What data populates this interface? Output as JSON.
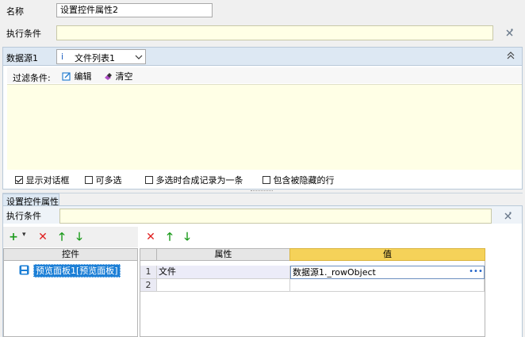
{
  "header": {
    "name_label": "名称",
    "name_value": "设置控件属性2",
    "condition_label": "执行条件",
    "clear_icon": "clear-icon"
  },
  "datasource": {
    "label": "数据源1",
    "combo_prefix": "i",
    "combo_value": "文件列表1",
    "collapse_icon": "double-chevron-up-icon"
  },
  "filter": {
    "label": "过滤条件:",
    "edit_label": "编辑",
    "clear_label": "清空"
  },
  "options": [
    {
      "label": "显示对话框",
      "checked": true
    },
    {
      "label": "可多选",
      "checked": false
    },
    {
      "label": "多选时合成记录为一条",
      "checked": false
    },
    {
      "label": "包含被隐藏的行",
      "checked": false
    }
  ],
  "tab": {
    "title": "设置控件属性",
    "condition_label": "执行条件"
  },
  "left_grid": {
    "header": "控件",
    "item": "预览面板1[预览面板]"
  },
  "right_grid": {
    "headers": [
      "属性",
      "值"
    ],
    "rows": [
      {
        "num": "1",
        "prop": "文件",
        "value": "数据源1._rowObject"
      },
      {
        "num": "2",
        "prop": "",
        "value": ""
      }
    ],
    "more": "•••"
  },
  "colors": {
    "accent_blue": "#1c7fd6",
    "value_header": "#f5d259",
    "yellow_bg": "#ffffe6"
  }
}
